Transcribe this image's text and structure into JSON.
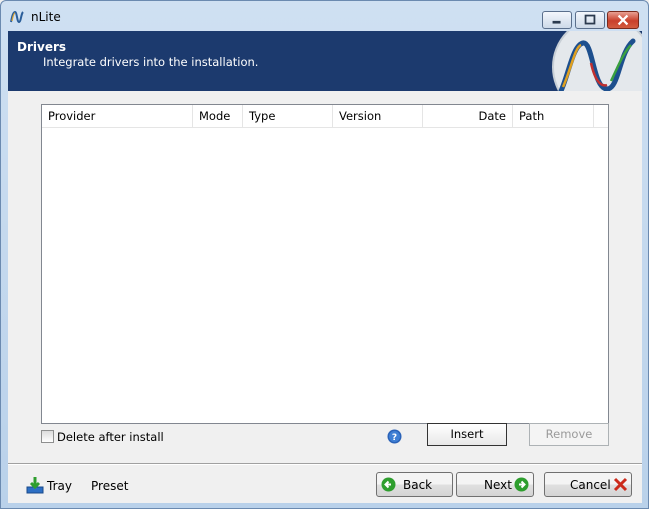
{
  "window": {
    "title": "nLite"
  },
  "banner": {
    "title": "Drivers",
    "subtitle": "Integrate drivers into the installation."
  },
  "list": {
    "columns": [
      "Provider",
      "Mode",
      "Type",
      "Version",
      "Date",
      "Path"
    ],
    "rows": []
  },
  "options": {
    "delete_after_install": {
      "label": "Delete after install",
      "checked": false
    }
  },
  "actions": {
    "insert": "Insert",
    "remove": "Remove"
  },
  "footer": {
    "tray": "Tray",
    "preset": "Preset",
    "back": "Back",
    "next": "Next",
    "cancel": "Cancel"
  },
  "colors": {
    "banner": "#1c3a6e",
    "back_arrow": "#2e9e2e",
    "next_arrow": "#2e9e2e",
    "cancel_x": "#cc2a1a"
  }
}
